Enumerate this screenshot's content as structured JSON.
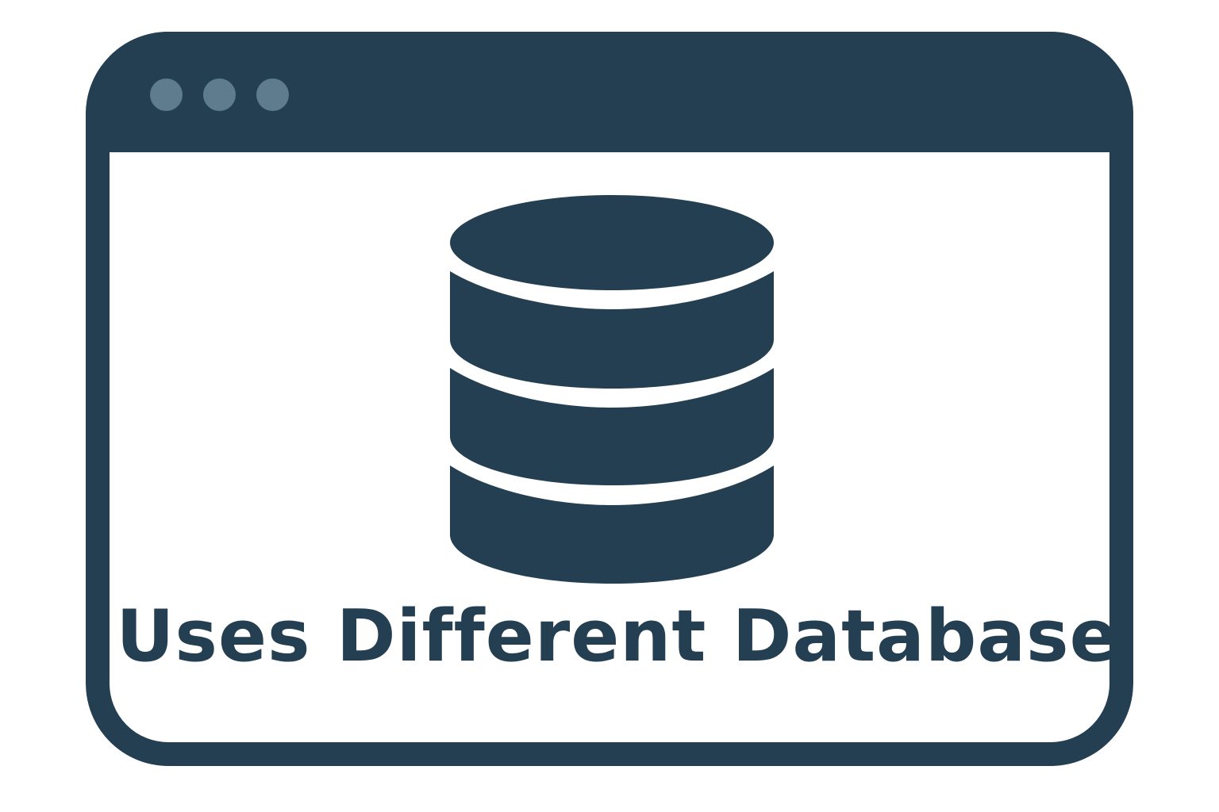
{
  "window": {
    "controls": [
      {
        "name": "window-control-dot"
      },
      {
        "name": "window-control-dot"
      },
      {
        "name": "window-control-dot"
      }
    ]
  },
  "content": {
    "icon": "database-icon",
    "caption": "Uses Different Database"
  },
  "colors": {
    "frame": "#243f51",
    "dots": "#5f7b8e",
    "background": "#ffffff",
    "text": "#243f51"
  }
}
